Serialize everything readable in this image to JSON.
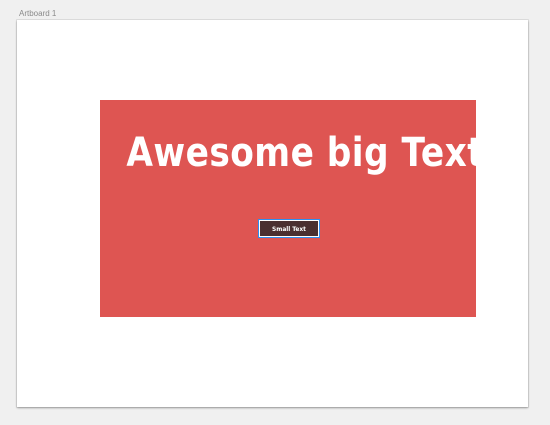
{
  "artboard": {
    "label": "Artboard 1"
  },
  "hero": {
    "title": "Awesome big Text",
    "button_label": "Small Text"
  },
  "colors": {
    "background": "#f0f0f0",
    "artboard": "#ffffff",
    "hero": "#de5552",
    "button": "#4a2f30",
    "selection": "#2f8ff0"
  }
}
